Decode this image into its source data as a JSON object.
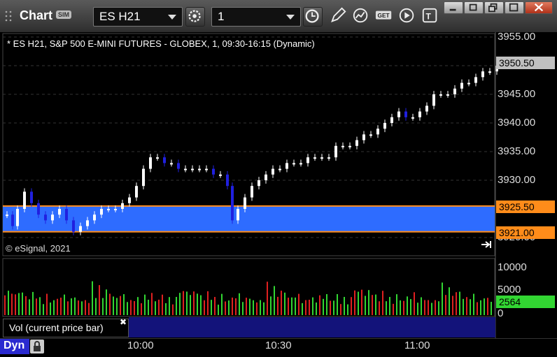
{
  "toolbar": {
    "window_title": "Chart",
    "sim_badge": "SIM",
    "symbol_value": "ES H21",
    "interval_value": "1"
  },
  "chart": {
    "header": "* ES H21, S&P 500 E-MINI FUTURES - GLOBEX, 1, 09:30-16:15 (Dynamic)",
    "copyright": "© eSignal, 2021",
    "price_axis_labels": [
      "3955.00",
      "3950.00",
      "3945.00",
      "3940.00",
      "3935.00",
      "3930.00",
      "3925.00",
      "3920.00"
    ],
    "last_price": "3950.50",
    "zone_top_price": "3925.50",
    "zone_bottom_price": "3921.00",
    "volume_axis_labels": [
      "10000",
      "5000",
      "0"
    ],
    "current_volume": "2564",
    "volume_study_label": "Vol (current price bar)",
    "time_labels": [
      "10:00",
      "10:30",
      "11:00"
    ],
    "dyn_label": "Dyn",
    "colors": {
      "up_candle": "#ffffff",
      "down_candle": "#2020e0",
      "zone_fill": "#2e6cff",
      "zone_border": "#ff8c1a",
      "vol_up": "#32d632",
      "vol_down": "#e02020",
      "last_price_tag": "#c0c0c0",
      "volume_tag": "#32d632"
    }
  }
}
